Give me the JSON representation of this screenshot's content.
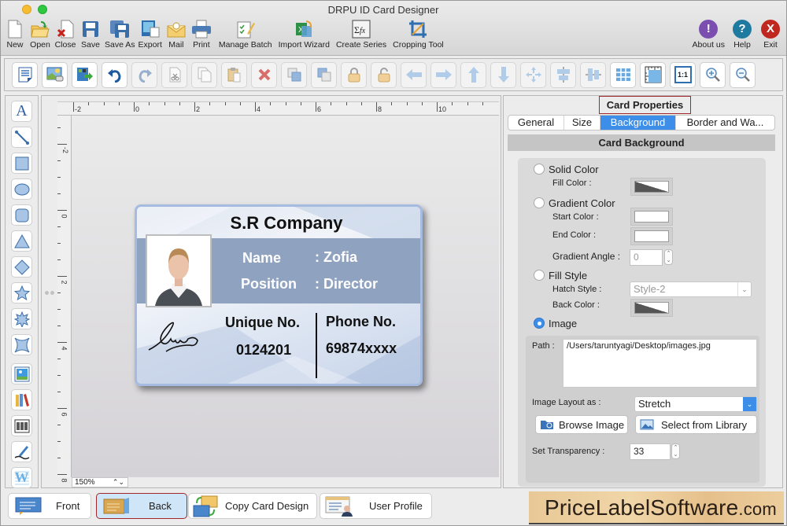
{
  "window": {
    "title": "DRPU ID Card Designer"
  },
  "main_toolbar": {
    "items": [
      {
        "label": "New",
        "icon": "new-document-icon"
      },
      {
        "label": "Open",
        "icon": "open-folder-icon"
      },
      {
        "label": "Close",
        "icon": "close-document-icon"
      },
      {
        "label": "Save",
        "icon": "save-icon"
      },
      {
        "label": "Save As",
        "icon": "save-as-icon"
      },
      {
        "label": "Export",
        "icon": "export-icon"
      },
      {
        "label": "Mail",
        "icon": "mail-icon"
      },
      {
        "label": "Print",
        "icon": "printer-icon"
      },
      {
        "label": "Manage Batch",
        "icon": "manage-batch-icon"
      },
      {
        "label": "Import Wizard",
        "icon": "import-wizard-icon"
      },
      {
        "label": "Create Series",
        "icon": "create-series-icon"
      },
      {
        "label": "Cropping Tool",
        "icon": "crop-icon"
      }
    ],
    "right_items": [
      {
        "label": "About us",
        "icon": "info-icon",
        "glyph": "!",
        "color": "#7b4fb0"
      },
      {
        "label": "Help",
        "icon": "help-icon",
        "glyph": "?",
        "color": "#1f7aa0"
      },
      {
        "label": "Exit",
        "icon": "exit-icon",
        "glyph": "X",
        "color": "#c0281f"
      }
    ]
  },
  "edit_toolbar": {
    "items": [
      {
        "name": "properties",
        "icon": "properties-icon",
        "enabled": true
      },
      {
        "name": "background-image",
        "icon": "image-settings-icon",
        "enabled": true
      },
      {
        "name": "export-image",
        "icon": "export-image-icon",
        "enabled": true
      },
      {
        "name": "undo",
        "icon": "undo-icon",
        "enabled": true
      },
      {
        "name": "redo",
        "icon": "redo-icon",
        "enabled": false
      },
      {
        "name": "cut",
        "icon": "cut-icon",
        "enabled": false
      },
      {
        "name": "copy",
        "icon": "copy-icon",
        "enabled": false
      },
      {
        "name": "paste",
        "icon": "paste-icon",
        "enabled": false
      },
      {
        "name": "delete",
        "icon": "delete-icon",
        "enabled": false
      },
      {
        "name": "bring-to-front",
        "icon": "bring-front-icon",
        "enabled": false
      },
      {
        "name": "send-to-back",
        "icon": "send-back-icon",
        "enabled": false
      },
      {
        "name": "lock",
        "icon": "lock-icon",
        "enabled": false
      },
      {
        "name": "unlock",
        "icon": "unlock-icon",
        "enabled": false
      },
      {
        "name": "move-left",
        "icon": "arrow-left-icon",
        "enabled": false
      },
      {
        "name": "move-right",
        "icon": "arrow-right-icon",
        "enabled": false
      },
      {
        "name": "move-up",
        "icon": "arrow-up-icon",
        "enabled": false
      },
      {
        "name": "move-down",
        "icon": "arrow-down-icon",
        "enabled": false
      },
      {
        "name": "center",
        "icon": "center-icon",
        "enabled": false
      },
      {
        "name": "align-horizontal",
        "icon": "align-horizontal-icon",
        "enabled": false
      },
      {
        "name": "align-vertical",
        "icon": "align-vertical-icon",
        "enabled": false
      },
      {
        "name": "grid",
        "icon": "grid-icon",
        "enabled": true
      },
      {
        "name": "ruler",
        "icon": "ruler-icon",
        "enabled": true
      },
      {
        "name": "actual-size",
        "icon": "actual-size-icon",
        "enabled": true,
        "glyph": "1:1"
      },
      {
        "name": "zoom-in",
        "icon": "zoom-in-icon",
        "enabled": true
      },
      {
        "name": "zoom-out",
        "icon": "zoom-out-icon",
        "enabled": true
      }
    ]
  },
  "palette": {
    "items": [
      {
        "name": "text",
        "icon": "text-tool-icon"
      },
      {
        "name": "line",
        "icon": "line-tool-icon"
      },
      {
        "name": "rectangle",
        "icon": "rectangle-tool-icon"
      },
      {
        "name": "ellipse",
        "icon": "ellipse-tool-icon"
      },
      {
        "name": "rounded-rectangle",
        "icon": "rounded-rectangle-tool-icon"
      },
      {
        "name": "triangle",
        "icon": "triangle-tool-icon"
      },
      {
        "name": "diamond",
        "icon": "diamond-tool-icon"
      },
      {
        "name": "star",
        "icon": "star-tool-icon"
      },
      {
        "name": "burst",
        "icon": "burst-tool-icon"
      },
      {
        "name": "four-point-star",
        "icon": "four-point-star-tool-icon"
      },
      {
        "name": "image",
        "icon": "picture-tool-icon"
      },
      {
        "name": "library",
        "icon": "library-tool-icon"
      },
      {
        "name": "barcode",
        "icon": "barcode-tool-icon"
      },
      {
        "name": "signature",
        "icon": "signature-tool-icon"
      },
      {
        "name": "watermark",
        "icon": "watermark-tool-icon"
      }
    ]
  },
  "canvas": {
    "ruler_h_labels": [
      "-2",
      "0",
      "2",
      "4",
      "6",
      "8",
      "10"
    ],
    "ruler_v_labels": [
      "-2",
      "0",
      "2",
      "4",
      "6",
      "8"
    ],
    "zoom_level": "150%"
  },
  "card": {
    "company": "S.R Company",
    "name_label": "Name",
    "name_value": ": Zofia",
    "position_label": "Position",
    "position_value": ": Director",
    "unique_label": "Unique No.",
    "unique_value": "0124201",
    "phone_label": "Phone No.",
    "phone_value": "69874xxxx"
  },
  "properties": {
    "title": "Card Properties",
    "tabs": [
      {
        "label": "General",
        "active": false
      },
      {
        "label": "Size",
        "active": false
      },
      {
        "label": "Background",
        "active": true
      },
      {
        "label": "Border and Wa...",
        "active": false
      }
    ],
    "section_title": "Card Background",
    "solid_color": {
      "label": "Solid Color",
      "checked": false,
      "fill_color_label": "Fill Color :"
    },
    "gradient_color": {
      "label": "Gradient Color",
      "checked": false,
      "start_label": "Start Color :",
      "end_label": "End Color :",
      "angle_label": "Gradient Angle :",
      "angle_value": "0"
    },
    "fill_style": {
      "label": "Fill Style",
      "checked": false,
      "hatch_label": "Hatch Style :",
      "hatch_value": "Style-2",
      "back_color_label": "Back Color :"
    },
    "image": {
      "label": "Image",
      "checked": true,
      "path_label": "Path :",
      "path_value": "/Users/taruntyagi/Desktop/images.jpg",
      "layout_label": "Image Layout as :",
      "layout_value": "Stretch",
      "browse_label": "Browse Image",
      "library_label": "Select from Library"
    },
    "transparency": {
      "label": "Set Transparency :",
      "value": "33"
    }
  },
  "bottom": {
    "front_label": "Front",
    "back_label": "Back",
    "copy_label": "Copy Card Design",
    "profile_label": "User Profile",
    "selected": "Back"
  },
  "brand": {
    "main": "PriceLabelSoftware",
    "suffix": ".com"
  }
}
